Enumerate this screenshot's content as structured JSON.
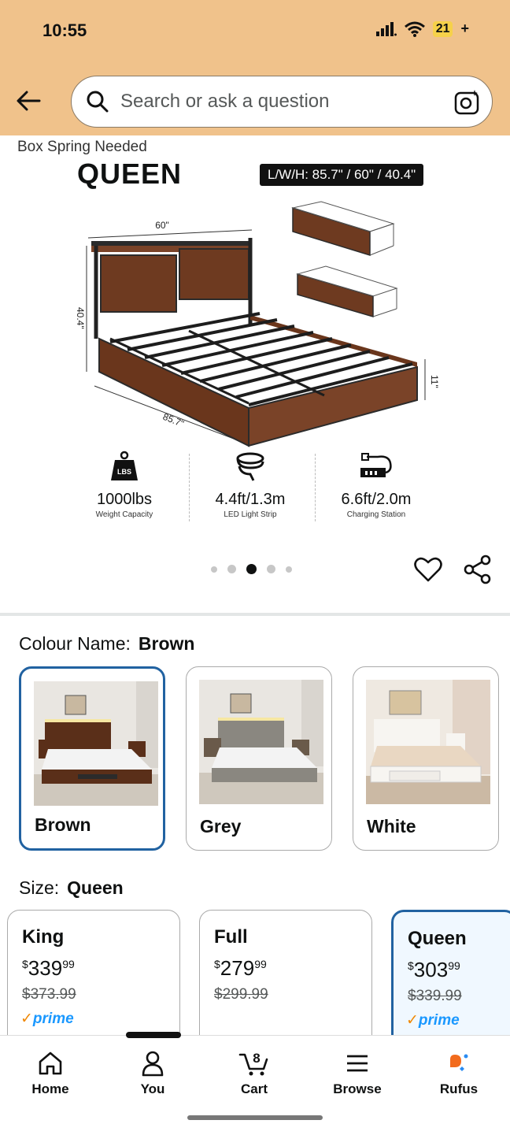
{
  "status_bar": {
    "time": "10:55",
    "battery": "21",
    "battery_suffix": "+"
  },
  "search": {
    "placeholder": "Search or ask a question"
  },
  "gallery": {
    "caption": "Box Spring Needed",
    "title": "QUEEN",
    "dims_badge": "L/W/H: 85.7\" / 60\" / 40.4\"",
    "dim_width": "60\"",
    "dim_height": "40.4\"",
    "dim_length": "85.7\"",
    "dim_clearance": "11\"",
    "features": [
      {
        "value": "1000lbs",
        "label": "Weight Capacity",
        "icon": "weight-icon",
        "icon_text": "LBS"
      },
      {
        "value": "4.4ft/1.3m",
        "label": "LED Light Strip",
        "icon": "led-strip-icon"
      },
      {
        "value": "6.6ft/2.0m",
        "label": "Charging Station",
        "icon": "power-strip-icon"
      }
    ],
    "image_count": 5,
    "active_image": 3
  },
  "colour": {
    "label": "Colour Name:",
    "selected": "Brown",
    "options": [
      {
        "name": "Brown",
        "selected": true,
        "color": "#6b3a22"
      },
      {
        "name": "Grey",
        "selected": false,
        "color": "#8a8780"
      },
      {
        "name": "White",
        "selected": false,
        "color": "#f2f0ec"
      }
    ]
  },
  "size": {
    "label": "Size:",
    "selected": "Queen",
    "options": [
      {
        "name": "King",
        "currency": "$",
        "price_whole": "339",
        "price_cents": "99",
        "was": "$373.99",
        "prime": "prime",
        "selected": false
      },
      {
        "name": "Full",
        "currency": "$",
        "price_whole": "279",
        "price_cents": "99",
        "was": "$299.99",
        "prime": "",
        "selected": false
      },
      {
        "name": "Queen",
        "currency": "$",
        "price_whole": "303",
        "price_cents": "99",
        "was": "$339.99",
        "prime": "prime",
        "selected": true
      }
    ]
  },
  "nav": {
    "items": [
      {
        "label": "Home",
        "icon": "home-icon"
      },
      {
        "label": "You",
        "icon": "person-icon"
      },
      {
        "label": "Cart",
        "icon": "cart-icon",
        "badge": "8"
      },
      {
        "label": "Browse",
        "icon": "menu-icon"
      },
      {
        "label": "Rufus",
        "icon": "rufus-icon"
      }
    ]
  },
  "colors": {
    "topbar": "#f0c28b",
    "accent_blue": "#2162a1",
    "prime_blue": "#1a98ff",
    "prime_check": "#f08804"
  }
}
